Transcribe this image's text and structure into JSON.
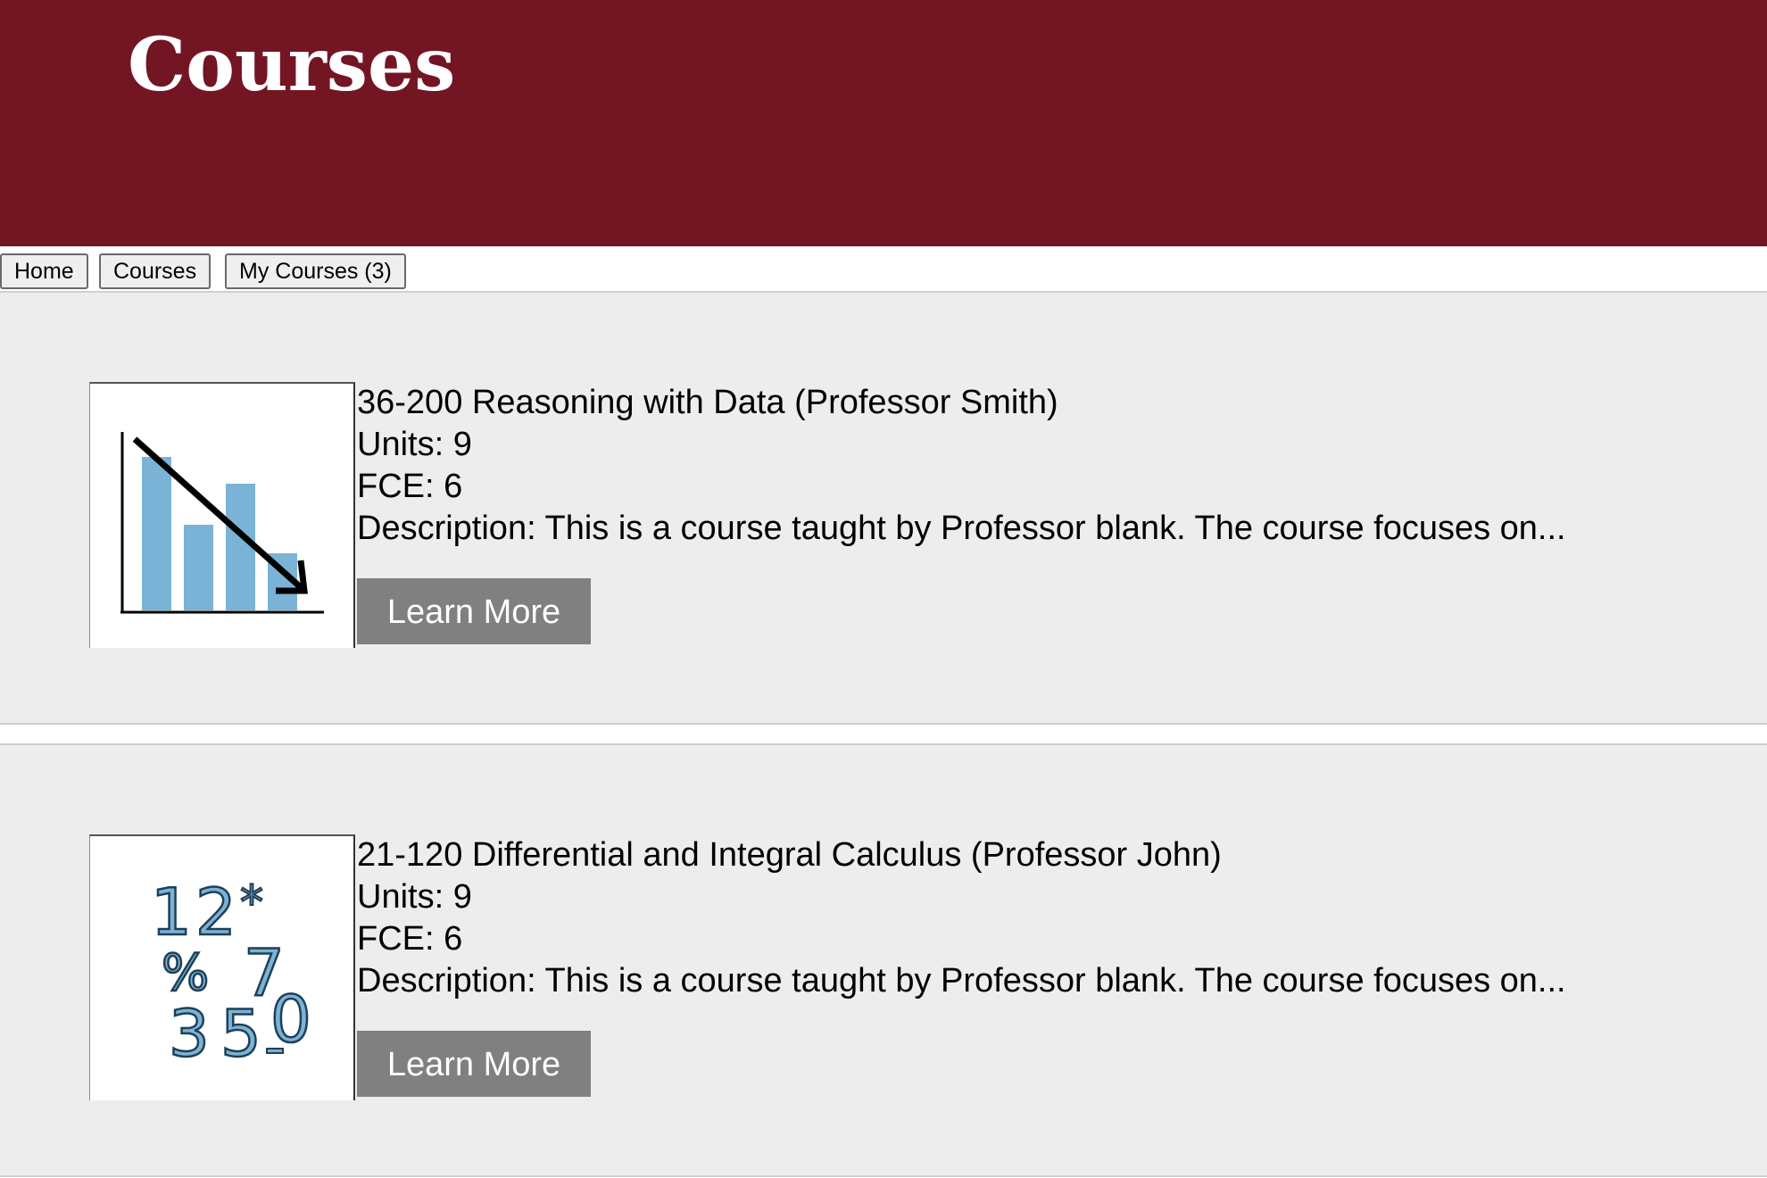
{
  "header": {
    "title": "Courses"
  },
  "nav": {
    "home_label": "Home",
    "courses_label": "Courses",
    "my_courses_label": "My Courses (3)"
  },
  "courses": [
    {
      "title": "36-200 Reasoning with Data (Professor Smith)",
      "units": "Units: 9",
      "fce": "FCE: 6",
      "description": "Description: This is a course taught by Professor blank. The course focuses on...",
      "button_label": "Learn More",
      "icon": "bar-chart-declining-icon"
    },
    {
      "title": "21-120 Differential and Integral Calculus (Professor John)",
      "units": "Units: 9",
      "fce": "FCE: 6",
      "description": "Description: This is a course taught by Professor blank. The course focuses on...",
      "button_label": "Learn More",
      "icon": "numbers-icon"
    }
  ],
  "colors": {
    "header_bg": "#741524",
    "section_bg": "#ededed",
    "button_bg": "#808080",
    "icon_blue": "#7ab3d6"
  }
}
